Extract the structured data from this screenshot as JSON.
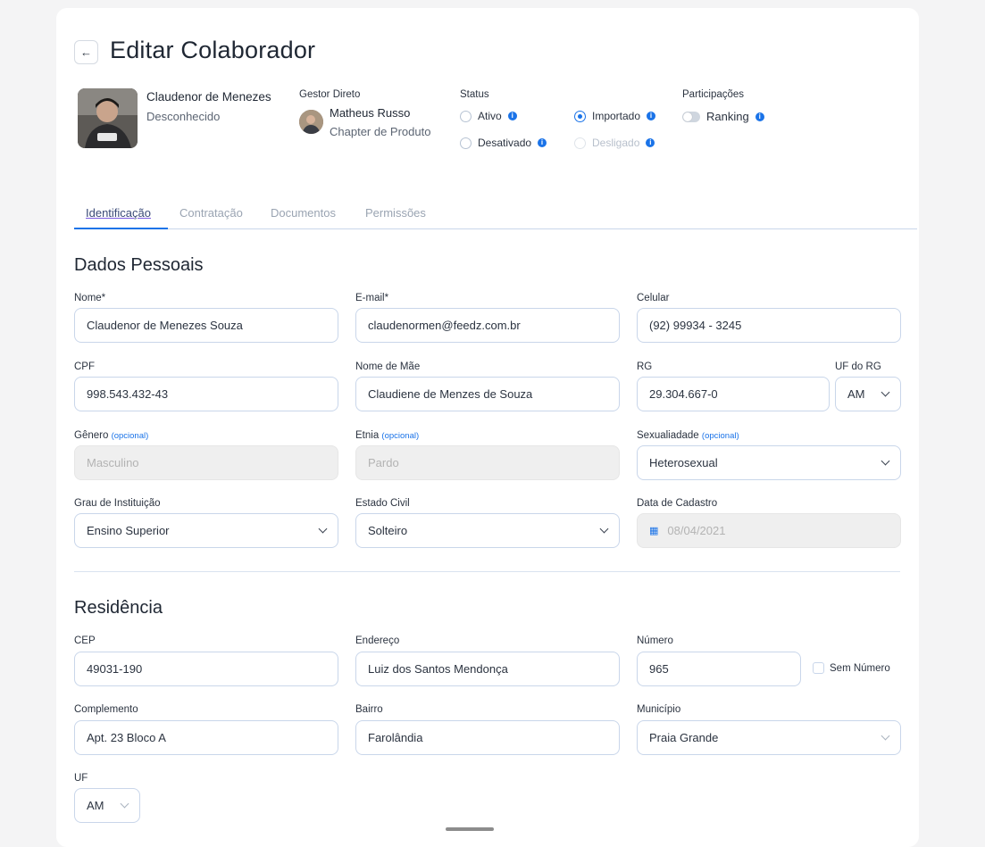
{
  "header": {
    "title": "Editar Colaborador"
  },
  "employee": {
    "name": "Claudenor de Menezes",
    "subtitle": "Desconhecido"
  },
  "manager": {
    "label": "Gestor Direto",
    "name": "Matheus Russo",
    "subtitle": "Chapter de Produto"
  },
  "status": {
    "label": "Status",
    "options": [
      {
        "label": "Ativo",
        "selected": false,
        "disabled": false
      },
      {
        "label": "Importado",
        "selected": true,
        "disabled": false
      },
      {
        "label": "Desativado",
        "selected": false,
        "disabled": false
      },
      {
        "label": "Desligado",
        "selected": false,
        "disabled": true
      }
    ]
  },
  "participations": {
    "label": "Participações",
    "ranking_label": "Ranking",
    "ranking_on": false
  },
  "tabs": [
    {
      "label": "Identificação",
      "active": true
    },
    {
      "label": "Contratação",
      "active": false
    },
    {
      "label": "Documentos",
      "active": false
    },
    {
      "label": "Permissões",
      "active": false
    }
  ],
  "personal": {
    "title": "Dados Pessoais",
    "optional_tag": "(opcional)",
    "nome": {
      "label": "Nome*",
      "value": "Claudenor de Menezes Souza"
    },
    "email": {
      "label": "E-mail*",
      "value": "claudenormen@feedz.com.br"
    },
    "celular": {
      "label": "Celular",
      "value": "(92) 99934 - 3245"
    },
    "cpf": {
      "label": "CPF",
      "value": "998.543.432-43"
    },
    "mae": {
      "label": "Nome de Mãe",
      "value": "Claudiene de Menzes de Souza"
    },
    "rg": {
      "label": "RG",
      "value": "29.304.667-0"
    },
    "uf_rg": {
      "label": "UF do RG",
      "value": "AM"
    },
    "genero": {
      "label": "Gênero",
      "value": "Masculino"
    },
    "etnia": {
      "label": "Etnia",
      "value": "Pardo"
    },
    "sexualidade": {
      "label": "Sexualiadade",
      "value": "Heterosexual"
    },
    "grau": {
      "label": "Grau de Instituição",
      "value": "Ensino Superior"
    },
    "estado_civil": {
      "label": "Estado Civil",
      "value": "Solteiro"
    },
    "cadastro": {
      "label": "Data de Cadastro",
      "value": "08/04/2021"
    }
  },
  "residence": {
    "title": "Residência",
    "cep": {
      "label": "CEP",
      "value": "49031-190"
    },
    "endereco": {
      "label": "Endereço",
      "value": "Luiz dos Santos Mendonça"
    },
    "numero": {
      "label": "Número",
      "value": "965"
    },
    "sem_numero": "Sem Número",
    "complemento": {
      "label": "Complemento",
      "value": "Apt. 23 Bloco A"
    },
    "bairro": {
      "label": "Bairro",
      "value": "Farolândia"
    },
    "municipio": {
      "label": "Município",
      "value": "Praia Grande"
    },
    "uf": {
      "label": "UF",
      "value": "AM"
    }
  }
}
